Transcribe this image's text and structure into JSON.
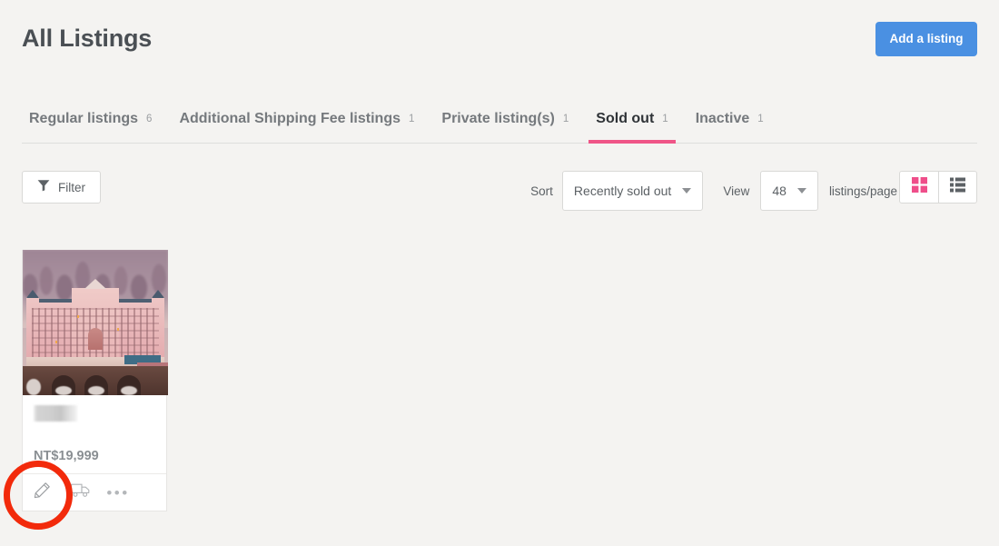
{
  "header": {
    "title": "All Listings",
    "add_listing_label": "Add a listing"
  },
  "tabs": [
    {
      "label": "Regular listings",
      "count": "6",
      "active": false,
      "name": "tab-regular-listings"
    },
    {
      "label": "Additional Shipping Fee listings",
      "count": "1",
      "active": false,
      "name": "tab-additional-shipping-fee-listings"
    },
    {
      "label": "Private listing(s)",
      "count": "1",
      "active": false,
      "name": "tab-private-listings"
    },
    {
      "label": "Sold out",
      "count": "1",
      "active": true,
      "name": "tab-sold-out"
    },
    {
      "label": "Inactive",
      "count": "1",
      "active": false,
      "name": "tab-inactive"
    }
  ],
  "toolbar": {
    "filter_label": "Filter",
    "filter_icon": "funnel-icon",
    "sort_label": "Sort",
    "sort_value": "Recently sold out",
    "view_label": "View",
    "view_value": "48",
    "listings_per_page_label": "listings/page",
    "grid_view_icon": "grid-view-icon",
    "list_view_icon": "list-view-icon",
    "active_view": "grid"
  },
  "listings": [
    {
      "title_redacted": true,
      "price": "NT$19,999",
      "image_alt": "grand-budapest-hotel-illustration",
      "actions": {
        "edit_icon": "pencil-icon",
        "shipping_icon": "truck-icon",
        "more_icon": "ellipsis-icon",
        "more_label": "•••"
      }
    }
  ],
  "annotation": {
    "shape": "circle",
    "color": "#f22a0b",
    "target": "edit-listing-button"
  },
  "colors": {
    "page_background": "#f4f3f1",
    "primary_button": "#4a90e2",
    "active_tab_underline": "#ef5587",
    "accent_pink": "#ef4e8a",
    "title_text": "#4a4f54"
  }
}
